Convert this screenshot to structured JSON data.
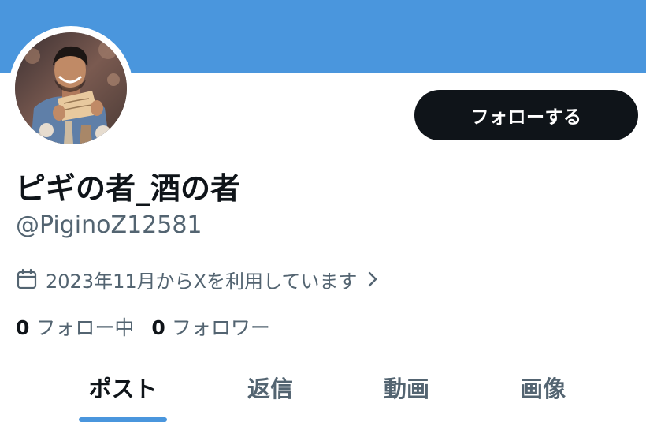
{
  "profile": {
    "display_name": "ピギの者_酒の者",
    "handle": "@PiginoZ12581",
    "joined_text": "2023年11月からXを利用しています",
    "follow_button_label": "フォローする"
  },
  "stats": {
    "following_count": "0",
    "following_label": "フォロー中",
    "followers_count": "0",
    "followers_label": "フォロワー"
  },
  "tabs": [
    {
      "label": "ポスト",
      "active": true
    },
    {
      "label": "返信",
      "active": false
    },
    {
      "label": "動画",
      "active": false
    },
    {
      "label": "画像",
      "active": false
    }
  ],
  "icons": {
    "joined": "calendar-icon",
    "joined_arrow": "chevron-right-icon"
  },
  "colors": {
    "banner": "#4a96dd",
    "follow_button": "#0f1419",
    "tab_indicator": "#4a96dd",
    "secondary_text": "#536471"
  }
}
